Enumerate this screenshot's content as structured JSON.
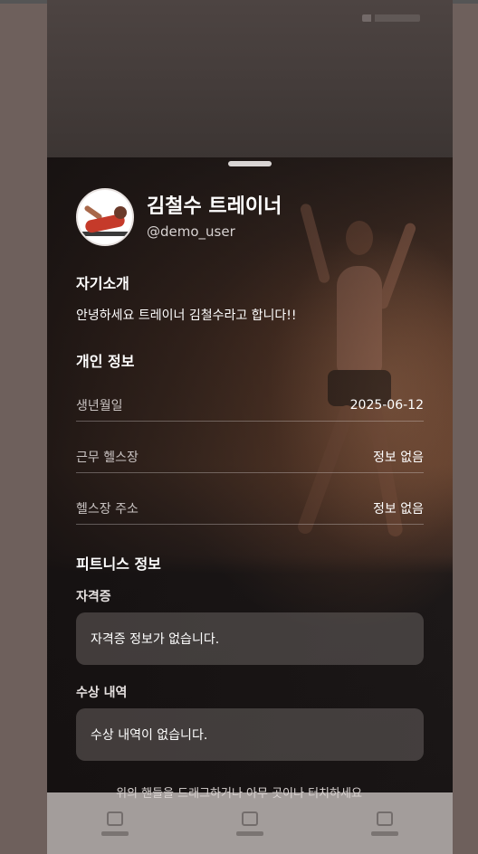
{
  "profile": {
    "name": "김철수 트레이너",
    "username": "@demo_user"
  },
  "intro": {
    "title": "자기소개",
    "text": "안녕하세요 트레이너 김철수라고 합니다!!"
  },
  "personal": {
    "title": "개인 정보",
    "rows": [
      {
        "label": "생년월일",
        "value": "2025-06-12"
      },
      {
        "label": "근무 헬스장",
        "value": "정보 없음"
      },
      {
        "label": "헬스장 주소",
        "value": "정보 없음"
      }
    ]
  },
  "fitness": {
    "title": "피트니스 정보",
    "certificates": {
      "label": "자격증",
      "empty": "자격증 정보가 없습니다."
    },
    "awards": {
      "label": "수상 내역",
      "empty": "수상 내역이 없습니다."
    }
  },
  "hint": "위의 핸들을 드래그하거나 아무 곳이나 터치하세요",
  "colors": {
    "sheet_background": "#1c1818",
    "text_primary": "#ffffff",
    "text_secondary": "#c9c3c2",
    "handle": "#d9d5d4"
  }
}
